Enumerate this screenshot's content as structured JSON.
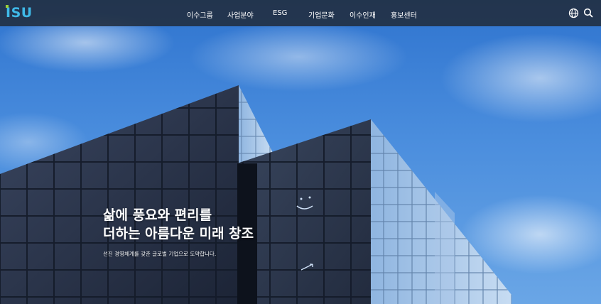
{
  "brand": {
    "logo_text": "ISU",
    "accent": "#3fb9e8",
    "dot_color": "#9bd13a"
  },
  "nav": {
    "items": [
      {
        "label": "이수그룹"
      },
      {
        "label": "사업분야"
      },
      {
        "label": "ESG"
      },
      {
        "label": "기업문화"
      },
      {
        "label": "이수인재"
      },
      {
        "label": "홍보센터"
      }
    ]
  },
  "utilities": {
    "language_icon": "globe-icon",
    "search_icon": "search-icon"
  },
  "hero": {
    "headline_line1": "삶에 풍요와 편리를",
    "headline_line2": "더하는 아름다운 미래 창조",
    "subtext": "선진 경영체계를 갖춘 글로벌 기업으로 도약합니다."
  },
  "colors": {
    "header_bg": "#212c3c",
    "sky": "#3f7fd0"
  }
}
